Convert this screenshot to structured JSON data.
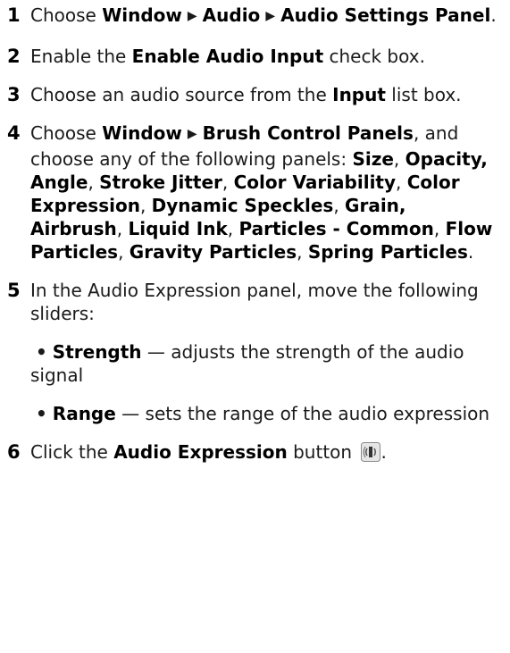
{
  "steps": [
    {
      "num": "1",
      "t1": "Choose ",
      "b1": "Window",
      "sep1": "▶",
      "b2": "Audio",
      "sep2": "▶",
      "b3": "Audio Settings Panel",
      "t2": "."
    },
    {
      "num": "2",
      "t1": "Enable the ",
      "b1": "Enable Audio Input",
      "t2": " check box."
    },
    {
      "num": "3",
      "t1": "Choose an audio source from the ",
      "b1": "Input",
      "t2": " list box."
    },
    {
      "num": "4",
      "t1": "Choose ",
      "b1": "Window",
      "sep1": "▶",
      "b2": "Brush Control Panels",
      "t2": ", and choose any of the following panels: ",
      "p1": "Size",
      "c1": ", ",
      "p2": "Opacity, Angle",
      "c2": ", ",
      "p3": "Stroke Jitter",
      "c3": ", ",
      "p4": "Color Variability",
      "c4": ", ",
      "p5": "Color Expression",
      "c5": ", ",
      "p6": "Dynamic Speckles",
      "c6": ", ",
      "p7": "Grain, Airbrush",
      "c7": ", ",
      "p8": "Liquid Ink",
      "c8": ", ",
      "p9": "Particles - Common",
      "c9": ", ",
      "p10": "Flow Particles",
      "c10": ", ",
      "p11": "Gravity Particles",
      "c11": ", ",
      "p12": "Spring Particles",
      "end": "."
    },
    {
      "num": "5",
      "t1": "In the Audio Expression panel, move the following sliders:",
      "sub": [
        {
          "bullet": "•",
          "label": "Strength",
          "desc": " — adjusts the strength of the audio signal"
        },
        {
          "bullet": "•",
          "label": "Range",
          "desc": " — sets the range of the audio expression"
        }
      ]
    },
    {
      "num": "6",
      "t1": "Click the ",
      "b1": "Audio Expression",
      "t2": " button ",
      "icon": "audio-expression-icon",
      "end": "."
    }
  ]
}
